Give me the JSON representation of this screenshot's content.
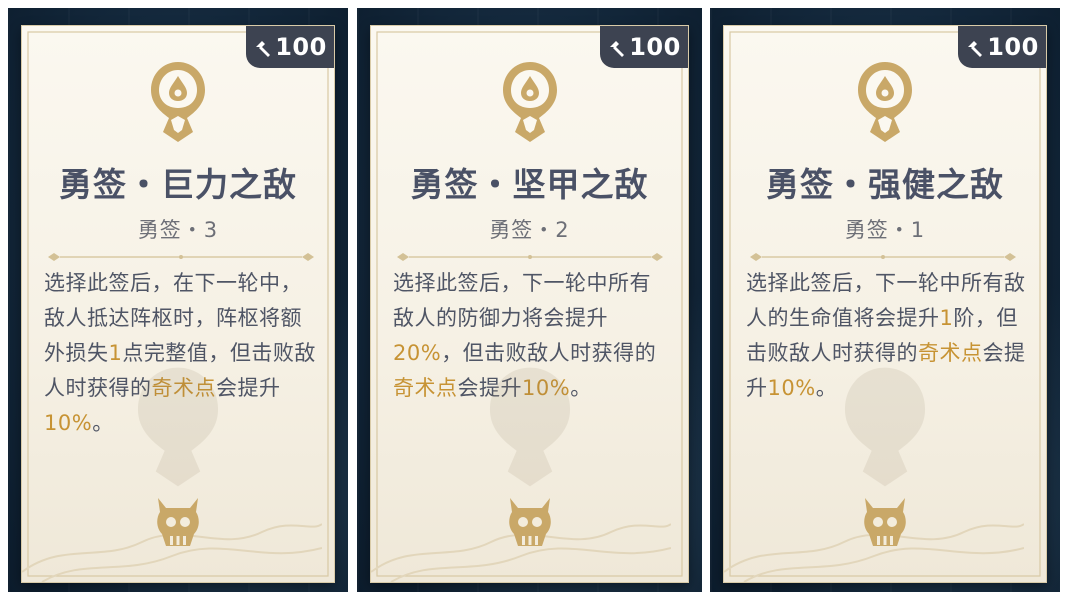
{
  "cards": [
    {
      "cost": "100",
      "title": "勇签・巨力之敌",
      "subtitle": "勇签・3",
      "desc": [
        {
          "t": "选择此签后，在下一轮中"
        },
        {
          "t": "，敌人抵达阵枢时，阵枢"
        },
        {
          "t": "将额外损失"
        },
        {
          "t": "1",
          "hl": true
        },
        {
          "t": "点完整值，但"
        },
        {
          "t": "击败敌人时获得的"
        },
        {
          "t": "奇术点",
          "hl": true
        },
        {
          "t": "会提升"
        },
        {
          "t": "10%",
          "hl": true
        },
        {
          "t": "。"
        }
      ]
    },
    {
      "cost": "100",
      "title": "勇签・坚甲之敌",
      "subtitle": "勇签・2",
      "desc": [
        {
          "t": "选择此签后，下一轮中所"
        },
        {
          "t": "有敌人的防御力将会提升"
        },
        {
          "t": "20%",
          "hl": true
        },
        {
          "t": "，但击败敌人时获得"
        },
        {
          "t": "的"
        },
        {
          "t": "奇术点",
          "hl": true
        },
        {
          "t": "会提升"
        },
        {
          "t": "10%",
          "hl": true
        },
        {
          "t": "。"
        }
      ]
    },
    {
      "cost": "100",
      "title": "勇签・强健之敌",
      "subtitle": "勇签・1",
      "desc": [
        {
          "t": "选择此签后，下一轮中所"
        },
        {
          "t": "有敌人的生命值将会提升"
        },
        {
          "t": "1",
          "hl": true
        },
        {
          "t": "阶，但击败敌人时获得的"
        },
        {
          "t": "奇术点",
          "hl": true
        },
        {
          "t": "会提升"
        },
        {
          "t": "10%",
          "hl": true
        },
        {
          "t": "。"
        }
      ]
    }
  ],
  "colors": {
    "highlight": "#c79334",
    "title": "#4a5166",
    "cost_badge": "#3d4351",
    "gold": "#c9a868"
  },
  "icons": {
    "cost": "hammer-icon",
    "emblem": "enemy-emblem-icon",
    "watermark": "skull-icon"
  }
}
